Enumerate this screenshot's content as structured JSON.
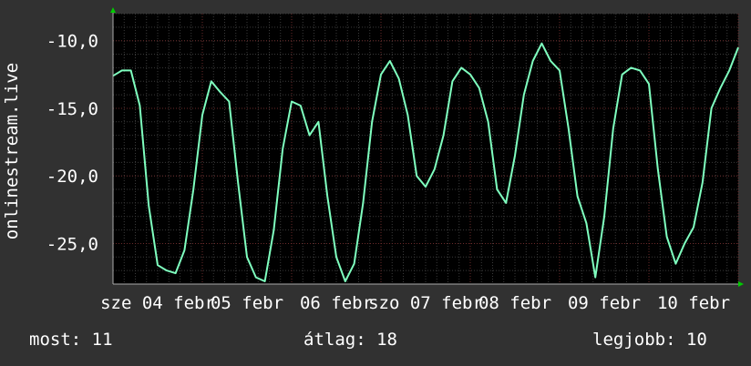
{
  "chart_data": {
    "type": "line",
    "ylabel": "onlinestream.live",
    "ylim": [
      -28,
      -8
    ],
    "y_ticks": [
      -10,
      -15,
      -20,
      -25
    ],
    "y_tick_labels": [
      "-10,0",
      "-15,0",
      "-20,0",
      "-25,0"
    ],
    "x_tick_labels": [
      "sze 04 febr",
      "csü 05 febr",
      "pén 06 febr",
      "szo 07 febr",
      "vas 08 febr",
      "hét 09 febr",
      "kedd 10 febr"
    ],
    "x_tick_labels_visible": [
      "sze 04 febr",
      "05 febr",
      "06 febr",
      "szo 07 febr",
      "08 febr",
      "09 febr",
      "10 febr"
    ],
    "grid": true,
    "series": [
      {
        "color": "#7fffbf",
        "x": [
          0.0,
          0.1,
          0.2,
          0.3,
          0.4,
          0.5,
          0.6,
          0.7,
          0.8,
          0.9,
          1.0,
          1.1,
          1.2,
          1.3,
          1.4,
          1.5,
          1.6,
          1.7,
          1.8,
          1.9,
          2.0,
          2.1,
          2.2,
          2.3,
          2.4,
          2.5,
          2.6,
          2.7,
          2.8,
          2.9,
          3.0,
          3.1,
          3.2,
          3.3,
          3.4,
          3.5,
          3.6,
          3.7,
          3.8,
          3.9,
          4.0,
          4.1,
          4.2,
          4.3,
          4.4,
          4.5,
          4.6,
          4.7,
          4.8,
          4.9,
          5.0,
          5.1,
          5.2,
          5.3,
          5.4,
          5.5,
          5.6,
          5.7,
          5.8,
          5.9,
          6.0,
          6.1,
          6.2,
          6.3,
          6.4,
          6.5,
          6.6,
          6.7,
          6.8,
          6.9,
          7.0
        ],
        "values": [
          -12.6,
          -12.2,
          -12.2,
          -14.8,
          -22.2,
          -26.6,
          -27.0,
          -27.2,
          -25.5,
          -21.0,
          -15.5,
          -13.0,
          -13.8,
          -14.5,
          -20.5,
          -26.0,
          -27.5,
          -27.8,
          -24.0,
          -18.0,
          -14.5,
          -14.8,
          -17.0,
          -16.0,
          -21.5,
          -26.0,
          -27.8,
          -26.5,
          -22.0,
          -16.0,
          -12.5,
          -11.5,
          -12.8,
          -15.5,
          -20.0,
          -20.8,
          -19.5,
          -17.0,
          -13.0,
          -12.0,
          -12.5,
          -13.5,
          -16.0,
          -21.0,
          -22.0,
          -18.5,
          -14.0,
          -11.5,
          -10.2,
          -11.5,
          -12.2,
          -16.5,
          -21.5,
          -23.5,
          -27.5,
          -23.0,
          -16.5,
          -12.5,
          -12.0,
          -12.2,
          -13.2,
          -19.5,
          -24.5,
          -26.5,
          -25.0,
          -23.8,
          -20.5,
          -15.0,
          -13.5,
          -12.2,
          -10.5
        ]
      }
    ]
  },
  "footer": {
    "current": "most: 11",
    "average": "átlag: 18",
    "best": "legjobb: 10"
  }
}
